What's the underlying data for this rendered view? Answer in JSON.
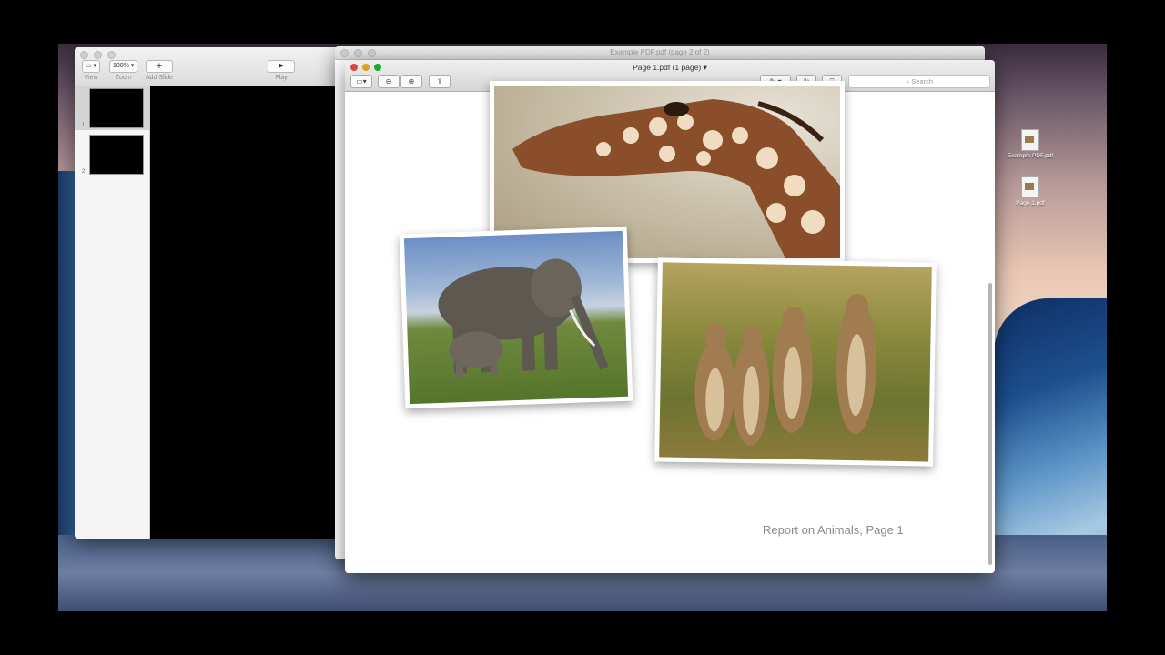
{
  "keynote": {
    "toolbar": {
      "view_label": "View",
      "zoom_value": "100%",
      "zoom_label": "Zoom",
      "add_slide_label": "Add Slide",
      "play_label": "Play"
    },
    "slides": [
      {
        "number": "1"
      },
      {
        "number": "2"
      }
    ]
  },
  "back_window": {
    "title": "Example PDF.pdf (page 2 of 2)"
  },
  "preview": {
    "title": "Page 1.pdf (1 page)",
    "search_placeholder": "Search",
    "caption": "Report on Animals, Page 1"
  },
  "desktop": {
    "icons": [
      {
        "label": "Example PDF.pdf"
      },
      {
        "label": "Page 1.pdf"
      }
    ]
  },
  "colors": {
    "close": "#e0443e",
    "minimize": "#dea123",
    "zoom": "#1aab29"
  },
  "icons": [
    "sidebar-icon",
    "zoom-out-icon",
    "zoom-in-icon",
    "share-icon",
    "annotate-icon",
    "rotate-icon",
    "toolbox-icon",
    "search-icon",
    "play-icon",
    "add-icon"
  ]
}
